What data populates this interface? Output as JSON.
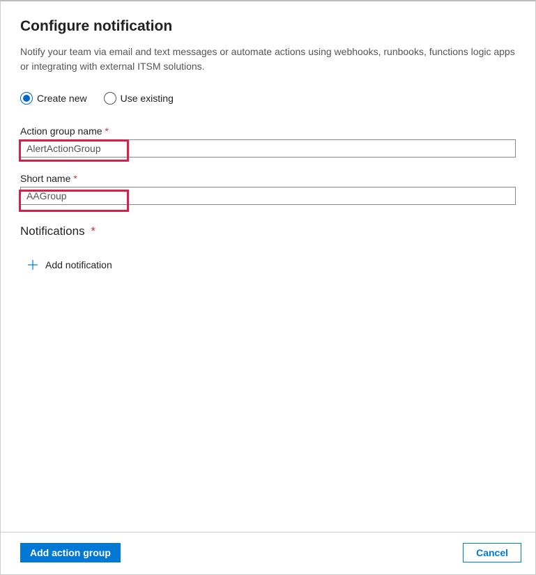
{
  "header": {
    "title": "Configure notification",
    "description": "Notify your team via email and text messages or automate actions using webhooks, runbooks, functions logic apps or integrating with external ITSM solutions."
  },
  "radio": {
    "create_new": "Create new",
    "use_existing": "Use existing",
    "selected": "create_new"
  },
  "fields": {
    "action_group_name": {
      "label": "Action group name",
      "value": "AlertActionGroup"
    },
    "short_name": {
      "label": "Short name",
      "value": "AAGroup"
    }
  },
  "notifications": {
    "title": "Notifications",
    "add_label": "Add notification"
  },
  "footer": {
    "primary": "Add action group",
    "secondary": "Cancel"
  },
  "required_marker": "*"
}
